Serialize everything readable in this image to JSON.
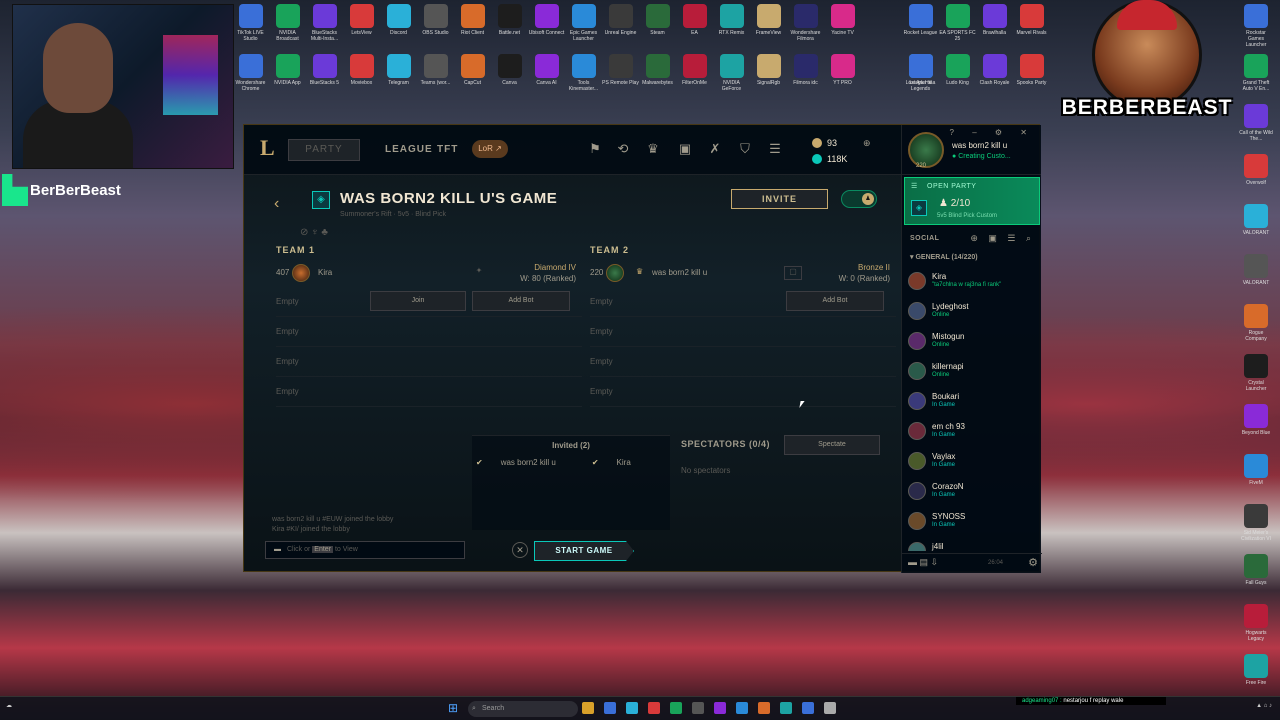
{
  "desktop": {
    "icons_row1": [
      "TikTok LIVE Studio",
      "NVIDIA Broadcast",
      "BlueStacks Multi-Insta...",
      "LetsView",
      "Discord",
      "OBS Studio",
      "Riot Client",
      "Battle.net",
      "Ubisoft Connect",
      "Epic Games Launcher",
      "Unreal Engine",
      "Steam",
      "EA",
      "RTX Remix",
      "FrameView",
      "Wondershare Filmora",
      "Yacine TV"
    ],
    "icons_row2": [
      "Wondershare Chrome",
      "NVIDIA App",
      "BlueStacks 5",
      "Moviebox",
      "Telegram",
      "Teams (wor...",
      "CapCut",
      "Canva",
      "Canva AI",
      "Tools Kinemaster...",
      "PS Remote Play",
      "Malwarebytes",
      "FilterOnMe",
      "NVIDIA GeForce",
      "SignalRgb",
      "Filmora idc",
      "YT PRO"
    ],
    "icons_right1": [
      "Rocket League",
      "EA SPORTS FC 25",
      "Brawlhalla",
      "Marvel Rivals",
      "League of Legends"
    ],
    "icons_right2": [
      "Lost Ark Hiaa",
      "Ludo King",
      "Clash Royale",
      "Spooks Party"
    ],
    "right_column": [
      "Rockstar Games Launcher",
      "Grand Theft Auto V En...",
      "Call of the Wild The...",
      "Overwolf",
      "VALORANT",
      "VALORANT",
      "Rogue Company",
      "Crystal Launcher",
      "Beyond Blue",
      "FiveM",
      "Sid Meier's Civilization VI",
      "Fall Guys",
      "Hogwarts Legacy",
      "Free Fire"
    ],
    "stream_tag": "BerBerBeast",
    "logo_text": "BERBERBEAST"
  },
  "client": {
    "party_button": "PARTY",
    "tabs": [
      "LEAGUE",
      "TFT"
    ],
    "lor_label": "LoR",
    "rp": "93",
    "be": "118K",
    "lobby": {
      "title": "WAS BORN2 KILL U'S GAME",
      "subtitle": "Summoner's Rift · 5v5 · Blind Pick",
      "invite_label": "INVITE"
    },
    "team1": {
      "label": "TEAM 1",
      "member": {
        "level": "407",
        "name": "Kira",
        "tier": "Diamond IV",
        "record": "W: 80 (Ranked)"
      },
      "join_label": "Join",
      "addbot_label": "Add Bot",
      "empty": [
        "Empty",
        "Empty",
        "Empty",
        "Empty"
      ]
    },
    "team2": {
      "label": "TEAM 2",
      "member": {
        "level": "220",
        "name": "was born2 kill u",
        "tier": "Bronze II",
        "record": "W: 0 (Ranked)"
      },
      "addbot_label": "Add Bot",
      "empty": [
        "Empty",
        "Empty",
        "Empty",
        "Empty"
      ]
    },
    "invited": {
      "header": "Invited (2)",
      "names": [
        "was born2 kill u",
        "Kira"
      ]
    },
    "spectators": {
      "header": "SPECTATORS (0/4)",
      "button": "Spectate",
      "empty": "No spectators"
    },
    "chat": {
      "lines": [
        "was born2 kill u #EUW joined the lobby",
        "Kira #KI/ joined the lobby"
      ],
      "placeholder_pre": "Click or",
      "placeholder_key": "Enter",
      "placeholder_post": "to View"
    },
    "start_label": "START GAME"
  },
  "social": {
    "me_name": "was born2 kill u",
    "me_status": "Creating Custo...",
    "me_level": "220",
    "open_party": "OPEN PARTY",
    "party_count": "2/10",
    "party_mode": "5v5 Blind Pick Custom",
    "header": "SOCIAL",
    "group": "GENERAL (14/220)",
    "friends": [
      {
        "name": "Kira",
        "status": "\"ta7chlna w raj3na fi rank\"",
        "color": "#0acb7a"
      },
      {
        "name": "Lydeghost",
        "status": "Online",
        "color": "#0acb7a"
      },
      {
        "name": "Mistogun",
        "status": "Online",
        "color": "#0acb7a"
      },
      {
        "name": "killernapi",
        "status": "Online",
        "color": "#0acb7a"
      },
      {
        "name": "Boukari",
        "status": "In Game",
        "color": "#0ac8b9"
      },
      {
        "name": "em ch 93",
        "status": "In Game",
        "color": "#0ac8b9"
      },
      {
        "name": "Vaylax",
        "status": "In Game",
        "color": "#0ac8b9"
      },
      {
        "name": "CorazoN",
        "status": "In Game",
        "color": "#0ac8b9"
      },
      {
        "name": "SYNOSS",
        "status": "In Game",
        "color": "#0ac8b9"
      },
      {
        "name": "j4lil",
        "status": "",
        "color": "#0ac8b9"
      }
    ],
    "time": "26:04"
  },
  "taskbar": {
    "search": "Search",
    "notification_user": "adgeaming07 :",
    "notification_msg": "nestarjou f replay wale"
  }
}
